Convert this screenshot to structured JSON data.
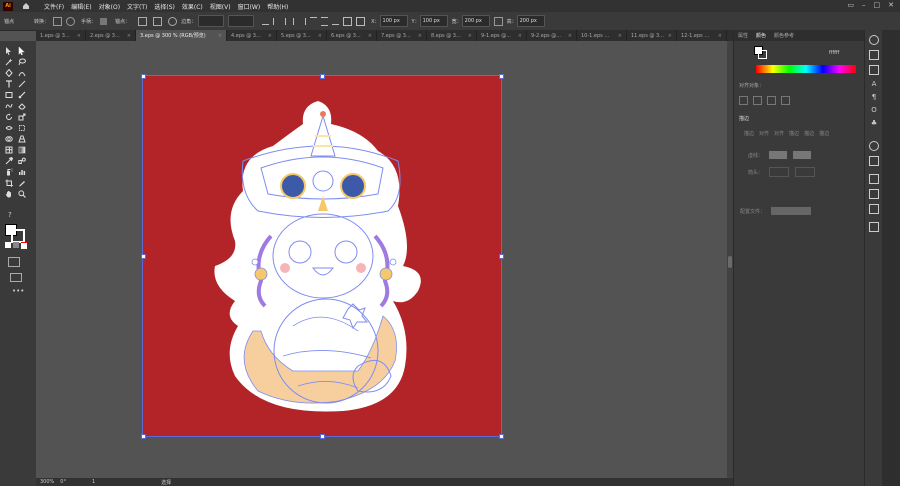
{
  "app": {
    "logo": "Ai"
  },
  "menu": [
    "文件(F)",
    "编辑(E)",
    "对象(O)",
    "文字(T)",
    "选择(S)",
    "效果(C)",
    "视图(V)",
    "窗口(W)",
    "帮助(H)"
  ],
  "control": {
    "left_label": "锚点",
    "convert_label": "转换：",
    "handle_label": "手柄：",
    "anchor_label": "锚点：",
    "edge_label": "边角：",
    "x_value": "100 px",
    "y_value": "100 px",
    "w_value": "200 px",
    "h_value": "200 px",
    "x_label": "X：",
    "y_label": "Y：",
    "w_label": "宽：",
    "h_label": "高："
  },
  "tabs": [
    {
      "label": "1.eps @ 3...",
      "active": false
    },
    {
      "label": "2.eps @ 3...",
      "active": false
    },
    {
      "label": "3.eps @ 300 % (RGB/预览)",
      "active": true
    },
    {
      "label": "4.eps @ 3...",
      "active": false
    },
    {
      "label": "5.eps @ 3...",
      "active": false
    },
    {
      "label": "6.eps @ 3...",
      "active": false
    },
    {
      "label": "7.eps @ 3...",
      "active": false
    },
    {
      "label": "8.eps @ 3...",
      "active": false
    },
    {
      "label": "9-1.eps @...",
      "active": false
    },
    {
      "label": "9-2.eps @...",
      "active": false
    },
    {
      "label": "10-1.eps ...",
      "active": false
    },
    {
      "label": "11.eps @ 3...",
      "active": false
    },
    {
      "label": "12-1.eps ...",
      "active": false
    }
  ],
  "panel": {
    "tab1": "属性",
    "tab2": "颜色",
    "tab3": "颜色参考",
    "hex": "ffffff",
    "align_label": "对齐对象：",
    "stroke_title": "描边",
    "stroke_row": [
      "描边",
      "对齐",
      "对齐",
      "描边",
      "描边",
      "描边"
    ],
    "dash_label": "虚线：",
    "arrow_label": "箭头：",
    "profile_label": "配置文件："
  },
  "status": {
    "zoom": "300%",
    "angle": "0°",
    "page": "1",
    "mode": "选择"
  },
  "colors": {
    "artboard": "#b22427",
    "accent": "#5b6ad6",
    "orange": "#e7683a"
  }
}
